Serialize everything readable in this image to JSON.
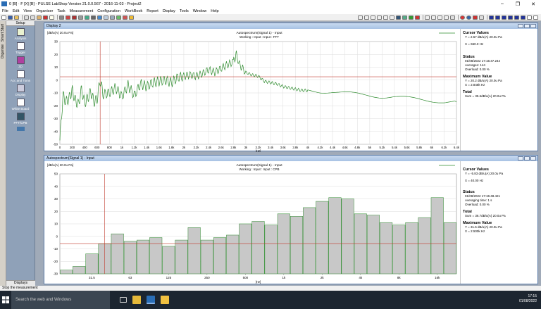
{
  "app": {
    "title": "0 [B] · F [X] [B] - PULSE LabShop Version 21.0.0.567 - 2016-11-03 - Project2",
    "menu": [
      "File",
      "Edit",
      "View",
      "Organiser",
      "Task",
      "Measurement",
      "Configuration",
      "WorkBook",
      "Report",
      "Display",
      "Tools",
      "Window",
      "Help"
    ]
  },
  "left_panel": {
    "header": "Setup",
    "items": [
      "Analysis",
      "Trigger",
      "3D",
      "Acc and Toms",
      "Display",
      "White Board",
      "PFT/CPB",
      "",
      ""
    ],
    "footer": "Displays",
    "strip_labels": [
      "Smart Start",
      "Organise"
    ]
  },
  "display2": {
    "window_title": "Display 2",
    "y_unit_label": "[dB/u(A) 20.0u Pa]",
    "plot_title": "Autospectrum(Signal 1) - Input",
    "plot_subtitle": "Working : Input : Input : FFT",
    "x_unit": "[Hz]",
    "cursor_title": "Cursor Values",
    "cursor_y": "Y = 2.57 dB/u(A) 20.0u Pa",
    "cursor_x": "X = 650.0 Hz",
    "status_title": "Status",
    "status_date": "01/08/2022  17:15:47.244",
    "status_avg": "Averages: 144",
    "status_over": "Overload:  0.00 %",
    "max_title": "Maximum Value",
    "max_y": "Y = 20.2 dB/u(A) 20.0u Pa",
    "max_x": "X = 2.848k Hz",
    "total_title": "Total",
    "total_sum": "Sum = 35.6dB/u(A) 20.0u Pa"
  },
  "display_cpb": {
    "window_title": "Autospectrum(Signal 1) - Input",
    "y_unit_label": "[dB/u(A) 20.0u Pa]",
    "plot_title": "Autospectrum(Signal 1) - Input",
    "plot_subtitle": "Working : Input : Input : CPB",
    "x_unit": "[Hz]",
    "cursor_title": "Cursor Values",
    "cursor_y": "Y = -5.83 dB/u(A) 20.0u Pa",
    "cursor_x": "X = 40.00 Hz",
    "status_title": "Status",
    "status_date": "01/08/2022  17:15:48.421",
    "status_avg": "Averaging time:      1 s",
    "status_over": "Overload:  0.00 %",
    "total_title": "Total",
    "total_sum": "Sum = 36.7dB/u(A) 20.0u Pa",
    "max_title": "Maximum Value",
    "max_y": "Y = 31.5 dB/u(A) 20.0u Pa",
    "max_x": "X = 2.500k Hz"
  },
  "chart_data": [
    {
      "type": "line",
      "title": "Autospectrum(Signal 1) - Input",
      "subtitle": "Working : Input : Input : FFT",
      "xlabel": "[Hz]",
      "ylabel": "[dB/u(A) 20.0u Pa]",
      "xlim": [
        0,
        6400
      ],
      "ylim": [
        -50,
        30
      ],
      "x_ticks": [
        "0",
        "200",
        "400",
        "600",
        "800",
        "1k",
        "1.2k",
        "1.4k",
        "1.6k",
        "1.8k",
        "2k",
        "2.2k",
        "2.4k",
        "2.6k",
        "2.8k",
        "3k",
        "3.2k",
        "3.4k",
        "3.6k",
        "3.8k",
        "4k",
        "4.2k",
        "4.4k",
        "4.6k",
        "4.8k",
        "5k",
        "5.2k",
        "5.4k",
        "5.6k",
        "5.8k",
        "6k",
        "6.2k",
        "6.4k"
      ],
      "y_ticks": [
        "30",
        "20",
        "10",
        "0",
        "-10",
        "-20",
        "-30",
        "-40",
        "-50"
      ],
      "cursor_x": 650,
      "reference_y": 2.57,
      "series": [
        {
          "color": "#2e8b2e",
          "x": [
            0,
            50,
            100,
            150,
            200,
            250,
            300,
            350,
            400,
            450,
            500,
            550,
            600,
            650,
            700,
            800,
            900,
            1000,
            1100,
            1200,
            1300,
            1400,
            1500,
            1600,
            1700,
            1800,
            1900,
            2000,
            2100,
            2200,
            2300,
            2400,
            2500,
            2600,
            2700,
            2800,
            2848,
            2900,
            3000,
            3100,
            3200,
            3300,
            3400,
            3500,
            3600,
            3700,
            3800,
            3900,
            4000,
            4200,
            4400,
            4600,
            4800,
            5000,
            5200,
            5400,
            5600,
            5800,
            6000,
            6200,
            6400
          ],
          "y": [
            -47,
            -12,
            -17,
            -14,
            -8,
            -16,
            -19,
            -7,
            -18,
            -14,
            -9,
            -17,
            -15,
            0,
            -11,
            -10,
            -6,
            -13,
            -4,
            -12,
            -3,
            -5,
            -2,
            -1,
            0,
            -2,
            2,
            3,
            4,
            3,
            5,
            8,
            6,
            9,
            12,
            14,
            20,
            12,
            6,
            4,
            3,
            -1,
            -2,
            -3,
            -5,
            -6,
            -7,
            -8,
            -8,
            -9,
            -9,
            -10,
            -11,
            -12,
            -13,
            -13,
            -14,
            -15,
            -16,
            -17,
            -17
          ]
        }
      ]
    },
    {
      "type": "bar",
      "title": "Autospectrum(Signal 1) - Input",
      "subtitle": "Working : Input : Input : CPB",
      "xlabel": "[Hz]",
      "ylabel": "[dB/u(A) 20.0u Pa]",
      "ylim": [
        -30,
        50
      ],
      "x_ticks": [
        "31.5",
        "63",
        "125",
        "250",
        "500",
        "1k",
        "2k",
        "4k",
        "8k",
        "16k"
      ],
      "y_ticks": [
        "50",
        "40",
        "30",
        "20",
        "10",
        "0",
        "-10",
        "-20",
        "-30"
      ],
      "cursor_band_index": 3,
      "reference_y": -5.83,
      "categories": [
        "20",
        "25",
        "31.5",
        "40",
        "50",
        "63",
        "80",
        "100",
        "125",
        "160",
        "200",
        "250",
        "315",
        "400",
        "500",
        "630",
        "800",
        "1k",
        "1.25k",
        "1.6k",
        "2k",
        "2.5k",
        "3.15k",
        "4k",
        "5k",
        "6.3k",
        "8k",
        "10k",
        "12.5k",
        "16k",
        "20k"
      ],
      "values": [
        -27,
        -24,
        -14,
        -6,
        2,
        -4,
        -3,
        -1,
        -8,
        -3,
        7,
        -3,
        -1,
        1,
        10,
        12,
        9,
        18,
        16,
        23,
        28,
        31,
        30,
        18,
        17,
        11,
        9,
        11,
        15,
        31,
        11
      ]
    }
  ],
  "statusbar": {
    "text": "Stop the measurement"
  },
  "taskbar": {
    "search_placeholder": "Search the web and Windows",
    "time": "17:15",
    "date": "01/08/2022"
  }
}
